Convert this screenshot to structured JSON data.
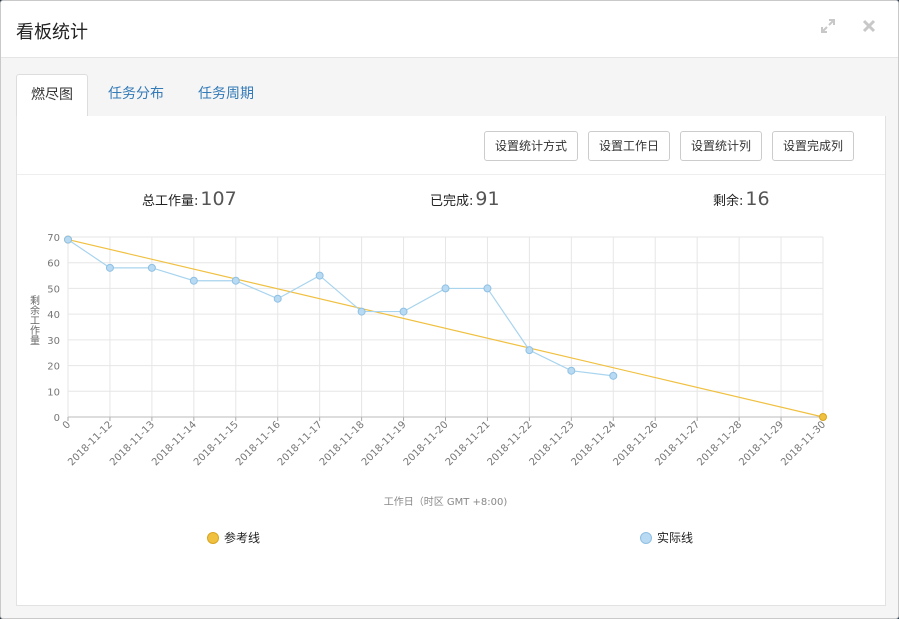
{
  "window": {
    "title": "看板统计",
    "expand_icon": "expand-icon",
    "close_icon": "close-icon"
  },
  "tabs": [
    {
      "label": "燃尽图",
      "active": true
    },
    {
      "label": "任务分布",
      "active": false
    },
    {
      "label": "任务周期",
      "active": false
    }
  ],
  "toolbar": {
    "buttons": [
      "设置统计方式",
      "设置工作日",
      "设置统计列",
      "设置完成列"
    ]
  },
  "stats": {
    "total_label": "总工作量:",
    "total_value": "107",
    "done_label": "已完成:",
    "done_value": "91",
    "remain_label": "剩余:",
    "remain_value": "16"
  },
  "colors": {
    "reference": "#f0c040",
    "actual": "#a8d0ec",
    "grid": "#e6e6e6"
  },
  "chart_data": {
    "type": "line",
    "xlabel": "工作日（时区 GMT +8:00)",
    "ylabel": "剩余工作量",
    "ylim": [
      0,
      70
    ],
    "yticks": [
      0,
      10,
      20,
      30,
      40,
      50,
      60,
      70
    ],
    "grid": true,
    "categories": [
      "0",
      "2018-11-12",
      "2018-11-13",
      "2018-11-14",
      "2018-11-15",
      "2018-11-16",
      "2018-11-17",
      "2018-11-18",
      "2018-11-19",
      "2018-11-20",
      "2018-11-21",
      "2018-11-22",
      "2018-11-23",
      "2018-11-24",
      "2018-11-26",
      "2018-11-27",
      "2018-11-28",
      "2018-11-29",
      "2018-11-30"
    ],
    "series": [
      {
        "name": "参考线",
        "values": [
          69,
          null,
          null,
          null,
          null,
          null,
          null,
          null,
          null,
          null,
          null,
          null,
          null,
          null,
          null,
          null,
          null,
          null,
          0
        ]
      },
      {
        "name": "实际线",
        "values": [
          69,
          58,
          58,
          53,
          53,
          46,
          55,
          41,
          41,
          50,
          50,
          26,
          18,
          16,
          null,
          null,
          null,
          null,
          null
        ]
      }
    ],
    "legend_position": "bottom"
  }
}
